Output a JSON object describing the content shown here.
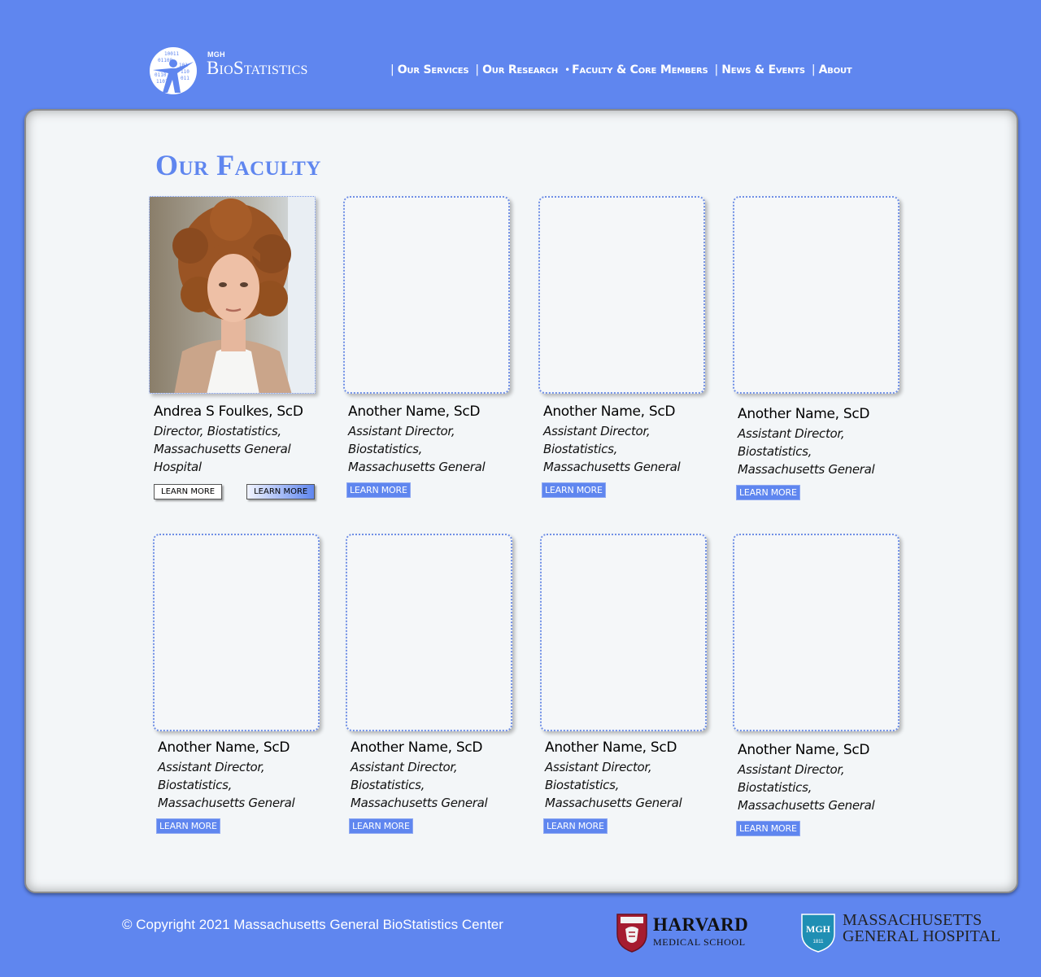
{
  "logo": {
    "small": "MGH",
    "big": "BioStatistics"
  },
  "nav": {
    "items": [
      {
        "prefix": "|",
        "label": "Our Services"
      },
      {
        "prefix": "|",
        "label": "Our Research"
      },
      {
        "prefix": "•",
        "label": "Faculty & Core Members"
      },
      {
        "prefix": "|",
        "label": "News & Events"
      },
      {
        "prefix": "|",
        "label": "About"
      }
    ]
  },
  "page": {
    "title": "Our Faculty"
  },
  "faculty": [
    {
      "name": "Andrea S Foulkes, ScD",
      "role": "Director, Biostatistics, Massachusetts General Hospital",
      "btn1": "LEARN MORE",
      "btn2": "LEARN MORE"
    },
    {
      "name": "Another Name, ScD",
      "role": "Assistant Director, Biostatistics, Massachusetts General",
      "btn": "LEARN MORE"
    },
    {
      "name": "Another Name, ScD",
      "role": "Assistant Director, Biostatistics, Massachusetts General",
      "btn": "LEARN MORE"
    },
    {
      "name": "Another Name, ScD",
      "role": "Assistant Director, Biostatistics, Massachusetts General",
      "btn": "LEARN MORE"
    },
    {
      "name": "Another Name, ScD",
      "role": "Assistant Director, Biostatistics, Massachusetts General",
      "btn": "LEARN MORE"
    },
    {
      "name": "Another Name, ScD",
      "role": "Assistant Director, Biostatistics, Massachusetts General",
      "btn": "LEARN MORE"
    },
    {
      "name": "Another Name, ScD",
      "role": "Assistant Director, Biostatistics, Massachusetts General",
      "btn": "LEARN MORE"
    },
    {
      "name": "Another Name, ScD",
      "role": "Assistant Director, Biostatistics, Massachusetts General",
      "btn": "LEARN MORE"
    }
  ],
  "footer": {
    "copyright": "© Copyright 2021 Massachusetts General BioStatistics Center",
    "harvard_line1": "HARVARD",
    "harvard_line2": "MEDICAL SCHOOL",
    "mgh_line1": "MASSACHUSETTS",
    "mgh_line2": "GENERAL HOSPITAL",
    "mgh_shield_text": "MGH",
    "mgh_shield_year": "1811"
  },
  "colors": {
    "brand": "#5f86ef",
    "panel": "#f3f6f8"
  }
}
